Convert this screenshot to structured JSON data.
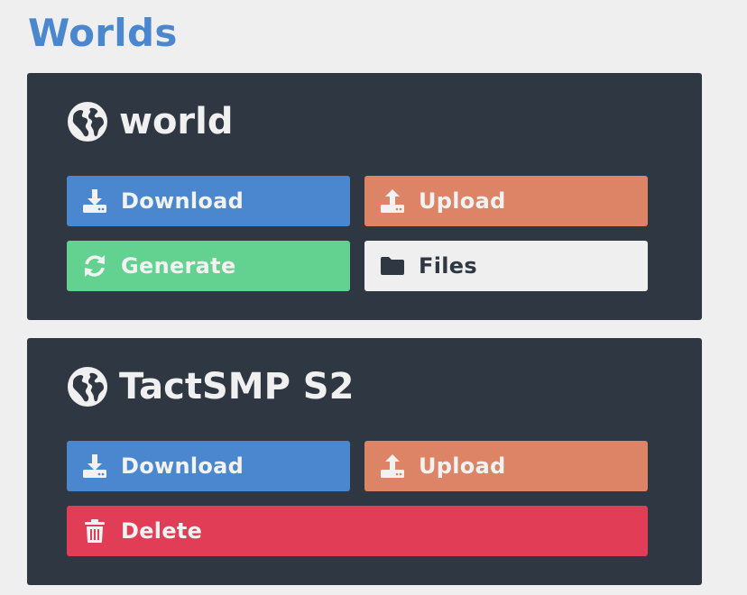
{
  "page": {
    "title": "Worlds"
  },
  "worlds": [
    {
      "name": "world",
      "icon": "globe-icon",
      "buttons": {
        "download": {
          "label": "Download",
          "icon": "download-icon",
          "color": "#4a87cf"
        },
        "upload": {
          "label": "Upload",
          "icon": "upload-icon",
          "color": "#dd8466"
        },
        "generate": {
          "label": "Generate",
          "icon": "sync-icon",
          "color": "#63d291"
        },
        "files": {
          "label": "Files",
          "icon": "folder-icon",
          "color": "#efefef"
        }
      }
    },
    {
      "name": "TactSMP S2",
      "icon": "globe-icon",
      "buttons": {
        "download": {
          "label": "Download",
          "icon": "download-icon",
          "color": "#4a87cf"
        },
        "upload": {
          "label": "Upload",
          "icon": "upload-icon",
          "color": "#dd8466"
        },
        "delete": {
          "label": "Delete",
          "icon": "trash-icon",
          "color": "#e23d56"
        }
      }
    }
  ],
  "colors": {
    "background": "#efefef",
    "card": "#2f3842",
    "title": "#4a87cf"
  }
}
